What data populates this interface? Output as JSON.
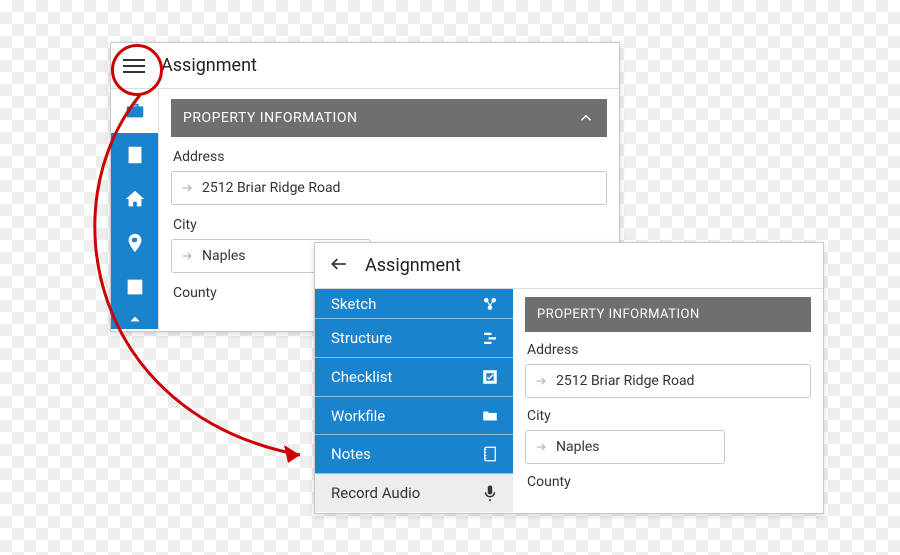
{
  "left": {
    "title": "Assignment",
    "section_title": "PROPERTY INFORMATION",
    "fields": {
      "address_label": "Address",
      "address_value": "2512 Briar Ridge Road",
      "city_label": "City",
      "city_value": "Naples",
      "county_label": "County"
    }
  },
  "right": {
    "title": "Assignment",
    "drawer": [
      {
        "label": "Sketch",
        "icon": "sketch"
      },
      {
        "label": "Structure",
        "icon": "structure"
      },
      {
        "label": "Checklist",
        "icon": "checklist"
      },
      {
        "label": "Workfile",
        "icon": "folder"
      },
      {
        "label": "Notes",
        "icon": "notes"
      }
    ],
    "drawer_light": {
      "label": "Record Audio",
      "icon": "mic"
    },
    "section_title": "PROPERTY INFORMATION",
    "fields": {
      "address_label": "Address",
      "address_value": "2512 Briar Ridge Road",
      "city_label": "City",
      "city_value": "Naples",
      "county_label": "County"
    }
  }
}
